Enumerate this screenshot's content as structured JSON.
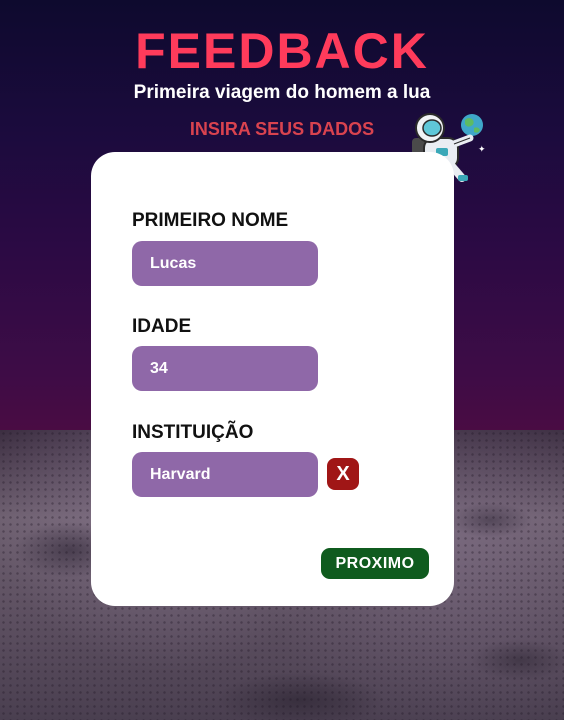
{
  "header": {
    "title": "FEEDBACK",
    "subtitle": "Primeira viagem do homem a lua",
    "prompt": "INSIRA SEUS DADOS"
  },
  "form": {
    "fields": [
      {
        "label": "PRIMEIRO NOME",
        "value": "Lucas"
      },
      {
        "label": "IDADE",
        "value": "34"
      },
      {
        "label": "INSTITUIÇÃO",
        "value": "Harvard"
      }
    ],
    "clear_label": "X",
    "next_label": "PROXIMO"
  },
  "icons": {
    "astronaut": "astronaut-icon"
  },
  "colors": {
    "title": "#ff3b5b",
    "prompt": "#d9434f",
    "input_bg": "#8f68a8",
    "clear_btn": "#a01616",
    "next_btn": "#0f5b1e"
  }
}
